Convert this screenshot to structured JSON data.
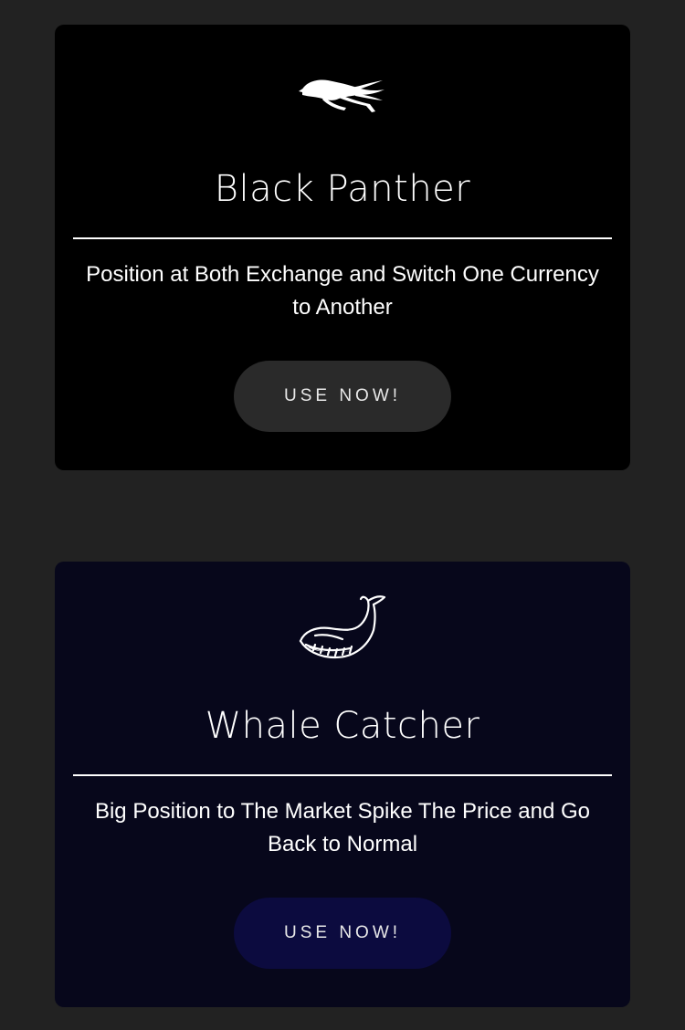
{
  "cards": [
    {
      "icon": "panther-icon",
      "title": "Black Panther",
      "description": "Position at Both Exchange and Switch One Currency to Another",
      "button_label": "USE NOW!",
      "background": "#000000",
      "button_color": "#2a2a2a"
    },
    {
      "icon": "whale-icon",
      "title": "Whale Catcher",
      "description": "Big Position to The Market Spike The Price and Go Back to Normal",
      "button_label": "USE NOW!",
      "background": "#07071b",
      "button_color": "#0c0b3f"
    }
  ],
  "colors": {
    "page_background": "#222222",
    "text": "#ffffff"
  }
}
